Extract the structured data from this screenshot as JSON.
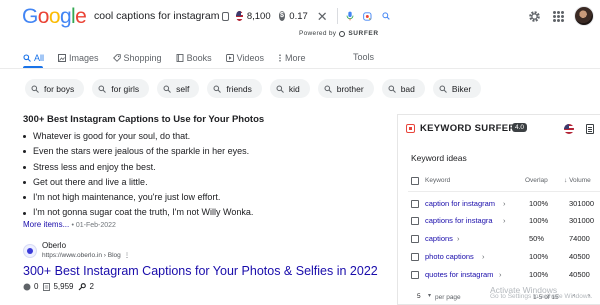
{
  "logo": "Google",
  "search": {
    "query": "cool captions for instagram",
    "search_volume": "8,100",
    "cpc": "0.17",
    "powered_by": "Powered by",
    "surfer_brand": "SURFER"
  },
  "tabs": [
    {
      "label": "All",
      "icon": "search-icon",
      "active": true
    },
    {
      "label": "Images",
      "icon": "image-icon"
    },
    {
      "label": "Shopping",
      "icon": "tag-icon"
    },
    {
      "label": "Books",
      "icon": "book-icon"
    },
    {
      "label": "Videos",
      "icon": "video-icon"
    },
    {
      "label": "More",
      "icon": "more-icon"
    }
  ],
  "tools_label": "Tools",
  "chips": [
    "for boys",
    "for girls",
    "self",
    "friends",
    "kid",
    "brother",
    "bad",
    "Biker"
  ],
  "snippet": {
    "title": "300+ Best Instagram Captions to Use for Your Photos",
    "items": [
      "Whatever is good for your soul, do that.",
      "Even the stars were jealous of the sparkle in her eyes.",
      "Stress less and enjoy the best.",
      "Get out there and live a little.",
      "I'm not high maintenance, you're just low effort.",
      "I'm not gonna sugar coat the truth, I'm not Willy Wonka."
    ],
    "more_items": "More items...",
    "date": "• 01-Feb-2022"
  },
  "result": {
    "source": "Oberlo",
    "url": "https://www.oberlo.in › Blog",
    "url_menu": "⋮",
    "title": "300+ Best Instagram Captions for Your Photos & Selfies in 2022",
    "meta": [
      {
        "icon": "dollar-icon",
        "value": "0"
      },
      {
        "icon": "document-icon",
        "value": "5,959"
      },
      {
        "icon": "link-icon",
        "value": "2"
      }
    ]
  },
  "keyword_surfer": {
    "title": "KEYWORD SURFER",
    "version": "4.0",
    "section_title": "Keyword ideas",
    "columns": {
      "keyword": "Keyword",
      "similarity": "Overlap",
      "volume": "Volume"
    },
    "rows": [
      {
        "keyword": "caption for instagram",
        "similarity": "100%",
        "volume": "301000"
      },
      {
        "keyword": "captions for instagra",
        "similarity": "100%",
        "volume": "301000"
      },
      {
        "keyword": "captions",
        "similarity": "50%",
        "volume": "74000"
      },
      {
        "keyword": "photo captions",
        "similarity": "100%",
        "volume": "40500"
      },
      {
        "keyword": "quotes for instagram",
        "similarity": "100%",
        "volume": "40500"
      }
    ],
    "pager": {
      "per_page": "5",
      "per_page_label": "per page",
      "range": "1-5 of 15"
    }
  },
  "watermark": {
    "line1": "Activate Windows",
    "line2": "Go to Settings to activate Windows."
  },
  "colors": {
    "google_blue": "#4285f4",
    "link": "#1a0dab",
    "accent": "#1a73e8",
    "surfer_red": "#e8453c"
  }
}
